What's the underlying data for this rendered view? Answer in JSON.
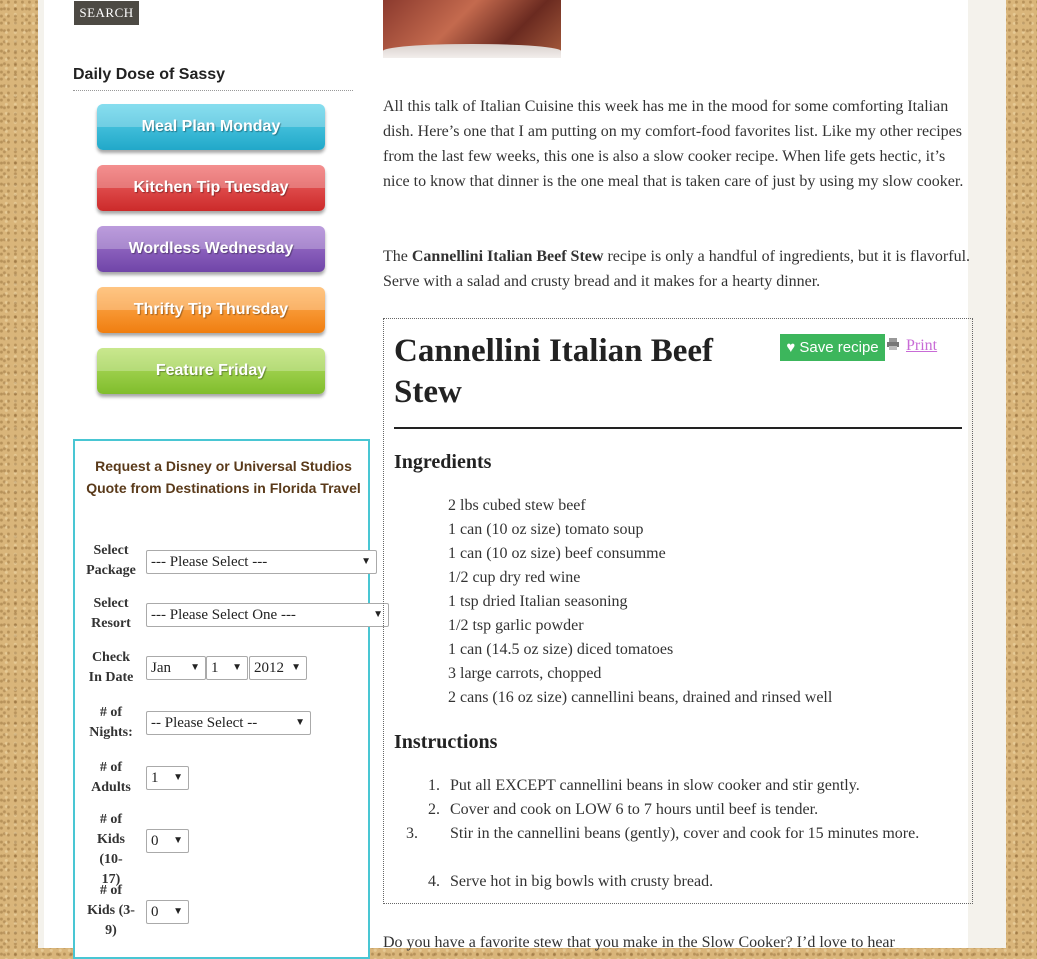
{
  "search": {
    "button_label": "SEARCH"
  },
  "sidebar": {
    "title": "Daily Dose of Sassy",
    "ribbons": [
      "Meal Plan Monday",
      "Kitchen Tip Tuesday",
      "Wordless Wednesday",
      "Thrifty Tip Thursday",
      "Feature Friday"
    ]
  },
  "quote_form": {
    "title": "Request a Disney or Universal Studios Quote from Destinations in Florida Travel",
    "fields": {
      "package": {
        "label_1": "Select",
        "label_2": "Package",
        "value": "--- Please Select ---"
      },
      "resort": {
        "label_1": "Select",
        "label_2": "Resort",
        "value": "--- Please Select One ---"
      },
      "checkin": {
        "label_1": "Check",
        "label_2": "In Date",
        "month": "Jan",
        "day": "1",
        "year": "2012"
      },
      "nights": {
        "label_1": "# of",
        "label_2": "Nights:",
        "value": "-- Please Select --"
      },
      "adults": {
        "label_1": "# of",
        "label_2": "Adults",
        "value": "1"
      },
      "kids_10_17": {
        "label_1": "# of",
        "label_2": "Kids (10-",
        "label_3": "17)",
        "value": "0"
      },
      "kids_3_9": {
        "label_1": "# of",
        "label_2": "Kids (3-",
        "label_3": "9)",
        "value": "0"
      }
    }
  },
  "article": {
    "intro": "All this talk of Italian Cuisine this week has me in the mood for some comforting Italian dish. Here’s one that I am putting on my comfort-food favorites list. Like my other recipes from the last few weeks, this one is also a slow cooker recipe. When life gets hectic, it’s nice to know that dinner is the one meal that is taken care of just by using my slow cooker.",
    "p2_pre": "The ",
    "p2_bold": "Cannellini Italian Beef Stew",
    "p2_post": " recipe is only a handful of ingredients, but it is flavorful. Serve with a salad and crusty bread and it makes for a hearty dinner.",
    "outro": "Do you have a favorite stew that you make in the Slow Cooker? I’d love to hear"
  },
  "recipe": {
    "title": "Cannellini Italian Beef Stew",
    "save_label": "♥ Save recipe",
    "print_label": "Print",
    "ingredients_heading": "Ingredients",
    "ingredients": [
      "2 lbs cubed stew beef",
      "1 can (10 oz size) tomato soup",
      "1 can (10 oz size) beef consumme",
      "1/2 cup dry red wine",
      "1 tsp dried Italian seasoning",
      "1/2 tsp garlic powder",
      "1 can (14.5 oz size) diced tomatoes",
      "3 large carrots, chopped",
      "2 cans (16 oz size) cannellini beans, drained and rinsed well"
    ],
    "instructions_heading": "Instructions",
    "instructions": [
      {
        "num": "1.",
        "text": "Put all EXCEPT cannellini beans in slow cooker and stir gently."
      },
      {
        "num": "2.",
        "text": "Cover and cook on LOW 6 to 7 hours until beef is tender."
      },
      {
        "num": "3.",
        "text": "Stir in the cannellini beans (gently), cover and cook for 15 minutes more."
      },
      {
        "num": "4.",
        "text": "Serve hot in big bowls with crusty bread."
      }
    ]
  }
}
